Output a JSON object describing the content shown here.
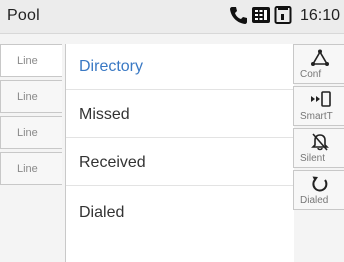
{
  "statusbar": {
    "title": "Pool",
    "time": "16:10",
    "icons": [
      "phone-icon",
      "keypad-icon",
      "tablet-icon"
    ]
  },
  "linekeys": [
    {
      "label": "Line"
    },
    {
      "label": "Line"
    },
    {
      "label": "Line"
    },
    {
      "label": "Line"
    }
  ],
  "menu": {
    "items": [
      {
        "label": "Directory",
        "selected": true
      },
      {
        "label": "Missed"
      },
      {
        "label": "Received"
      },
      {
        "label": "Dialed"
      }
    ]
  },
  "softkeys": [
    {
      "label": "Conf",
      "icon": "conference-icon"
    },
    {
      "label": "SmartT",
      "icon": "smart-transfer-icon"
    },
    {
      "label": "Silent",
      "icon": "silent-bell-icon"
    },
    {
      "label": "Dialed",
      "icon": "redial-icon"
    }
  ],
  "colors": {
    "accent": "#3a79c4",
    "background": "#f4f4f4",
    "icon": "#1a1a1a"
  }
}
